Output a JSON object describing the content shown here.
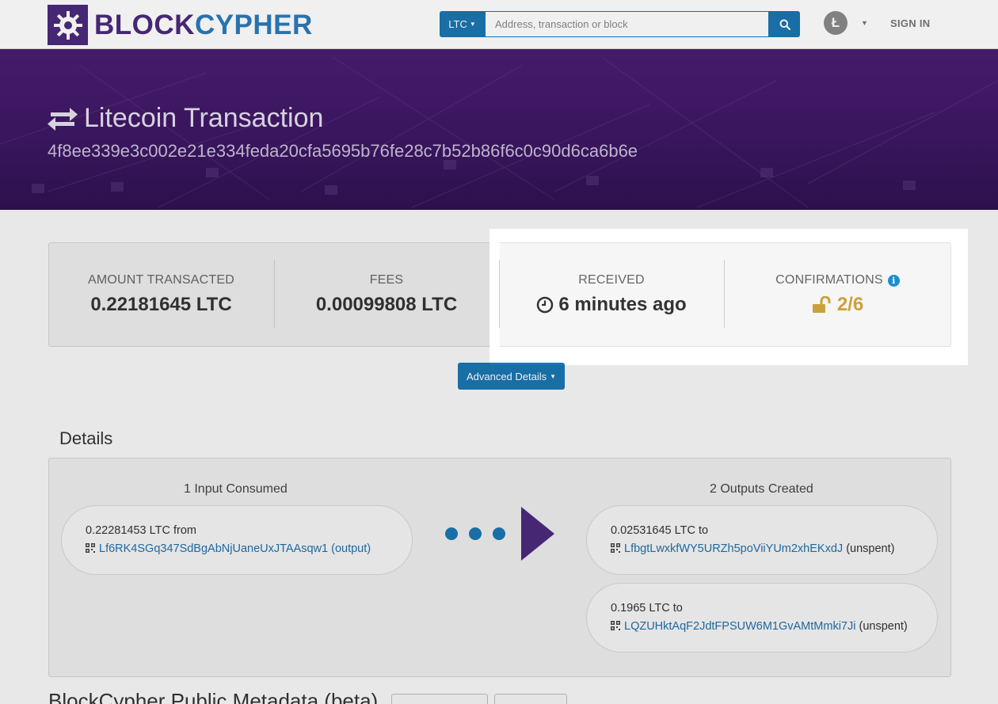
{
  "header": {
    "logo_part1": "BLOCK",
    "logo_part2": "CYPHER",
    "coin_selector": "LTC",
    "search_placeholder": "Address, transaction or block",
    "avatar_glyph": "Ł",
    "signin_label": "SIGN IN"
  },
  "hero": {
    "title": "Litecoin Transaction",
    "tx_hash": "4f8ee339e3c002e21e334feda20cfa5695b76fe28c7b52b86f6c0c90d6ca6b6e"
  },
  "summary": {
    "amount_label": "AMOUNT TRANSACTED",
    "amount_value": "0.22181645 LTC",
    "fees_label": "FEES",
    "fees_value": "0.00099808 LTC",
    "received_label": "RECEIVED",
    "received_value": "6 minutes ago",
    "confirmations_label": "CONFIRMATIONS",
    "confirmations_value": "2/6"
  },
  "advanced_button": "Advanced Details",
  "details": {
    "heading": "Details",
    "inputs_heading": "1 Input Consumed",
    "outputs_heading": "2 Outputs Created",
    "inputs": [
      {
        "amount": "0.22281453 LTC from",
        "address": "Lf6RK4SGq347SdBgAbNjUaneUxJTAAsqw1",
        "link": "(output)"
      }
    ],
    "outputs": [
      {
        "amount": "0.02531645 LTC to",
        "address": "LfbgtLwxkfWY5URZh5poViiYUm2xhEKxdJ",
        "status": "(unspent)"
      },
      {
        "amount": "0.1965 LTC to",
        "address": "LQZUHktAqF2JdtFPSUW6M1GvAMtMmki7Ji",
        "status": "(unspent)"
      }
    ]
  },
  "metadata": {
    "heading": "BlockCypher Public Metadata (beta)"
  },
  "colors": {
    "brand_purple": "#4b2a7b",
    "brand_blue": "#1a75b0",
    "confirm_gold": "#c9a23c",
    "link_blue": "#1f6fa8"
  }
}
